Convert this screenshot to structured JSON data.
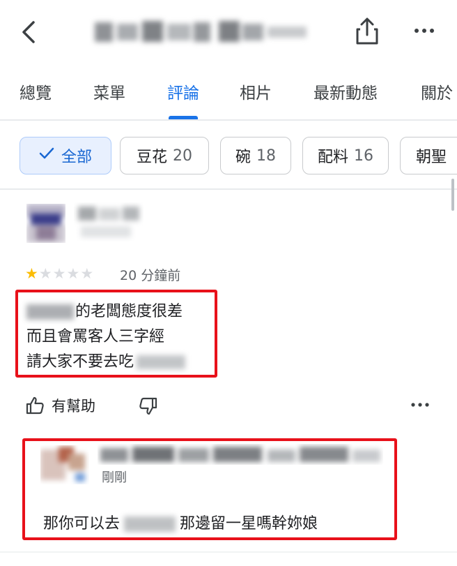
{
  "header": {
    "back_icon": "back-arrow-icon",
    "share_icon": "share-icon",
    "more_icon": "more-horizontal-icon"
  },
  "tabs": [
    {
      "label": "總覽"
    },
    {
      "label": "菜單"
    },
    {
      "label": "評論",
      "active": true
    },
    {
      "label": "相片"
    },
    {
      "label": "最新動態"
    },
    {
      "label": "關於"
    }
  ],
  "chips": {
    "all": {
      "label": "全部",
      "icon": "check-icon"
    },
    "items": [
      {
        "label": "豆花",
        "count": "20"
      },
      {
        "label": "碗",
        "count": "18"
      },
      {
        "label": "配料",
        "count": "16"
      },
      {
        "label": "朝聖"
      }
    ]
  },
  "review": {
    "rating": 1,
    "rating_max": 5,
    "time_ago": "20 分鐘前",
    "lines": [
      "的老闆態度很差",
      "而且會罵客人三字經",
      "請大家不要去吃"
    ],
    "helpful_label": "有幫助"
  },
  "reply": {
    "time": "剛剛",
    "text_before": "那你可以去",
    "text_after": "那邊留一星嗎幹妳娘"
  },
  "colors": {
    "accent": "#1a73e8",
    "star": "#fbbc04",
    "highlight_box": "#e8111a"
  }
}
